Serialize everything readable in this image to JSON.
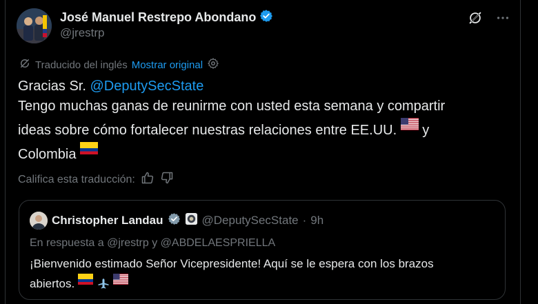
{
  "tweet": {
    "author": {
      "display_name": "José Manuel Restrepo Abondano",
      "handle": "@jrestrp",
      "verified": true,
      "avatar_icon": "user-avatar"
    },
    "actions": {
      "grok_icon": "grok-icon",
      "more_icon": "more-horizontal-icon"
    },
    "translation": {
      "label": "Traducido del inglés",
      "show_original": "Mostrar original"
    },
    "body": {
      "line1_prefix": "Gracias Sr. ",
      "line1_mention": "@DeputySecState",
      "line2": "Tengo muchas ganas de reunirme con usted esta semana y compartir",
      "line3_text": "ideas sobre cómo fortalecer nuestras relaciones entre EE.UU.",
      "line3_suffix": "y",
      "line4_text": "Colombia"
    },
    "rate": {
      "label": "Califica esta traducción:"
    }
  },
  "quoted_tweet": {
    "author": {
      "display_name": "Christopher Landau",
      "handle": "@DeputySecState",
      "separator": "·",
      "time": "9h",
      "verified": true
    },
    "reply_context": "En respuesta a @jrestrp y @ABDELAESPRIELLA",
    "body": {
      "line1": "¡Bienvenido estimado Señor Vicepresidente! Aquí se le espera con los brazos",
      "line2": "abiertos."
    }
  },
  "colors": {
    "background": "#000000",
    "text": "#e7e9ea",
    "secondary": "#71767b",
    "accent": "#1d9bf0",
    "border": "#2f3336"
  }
}
